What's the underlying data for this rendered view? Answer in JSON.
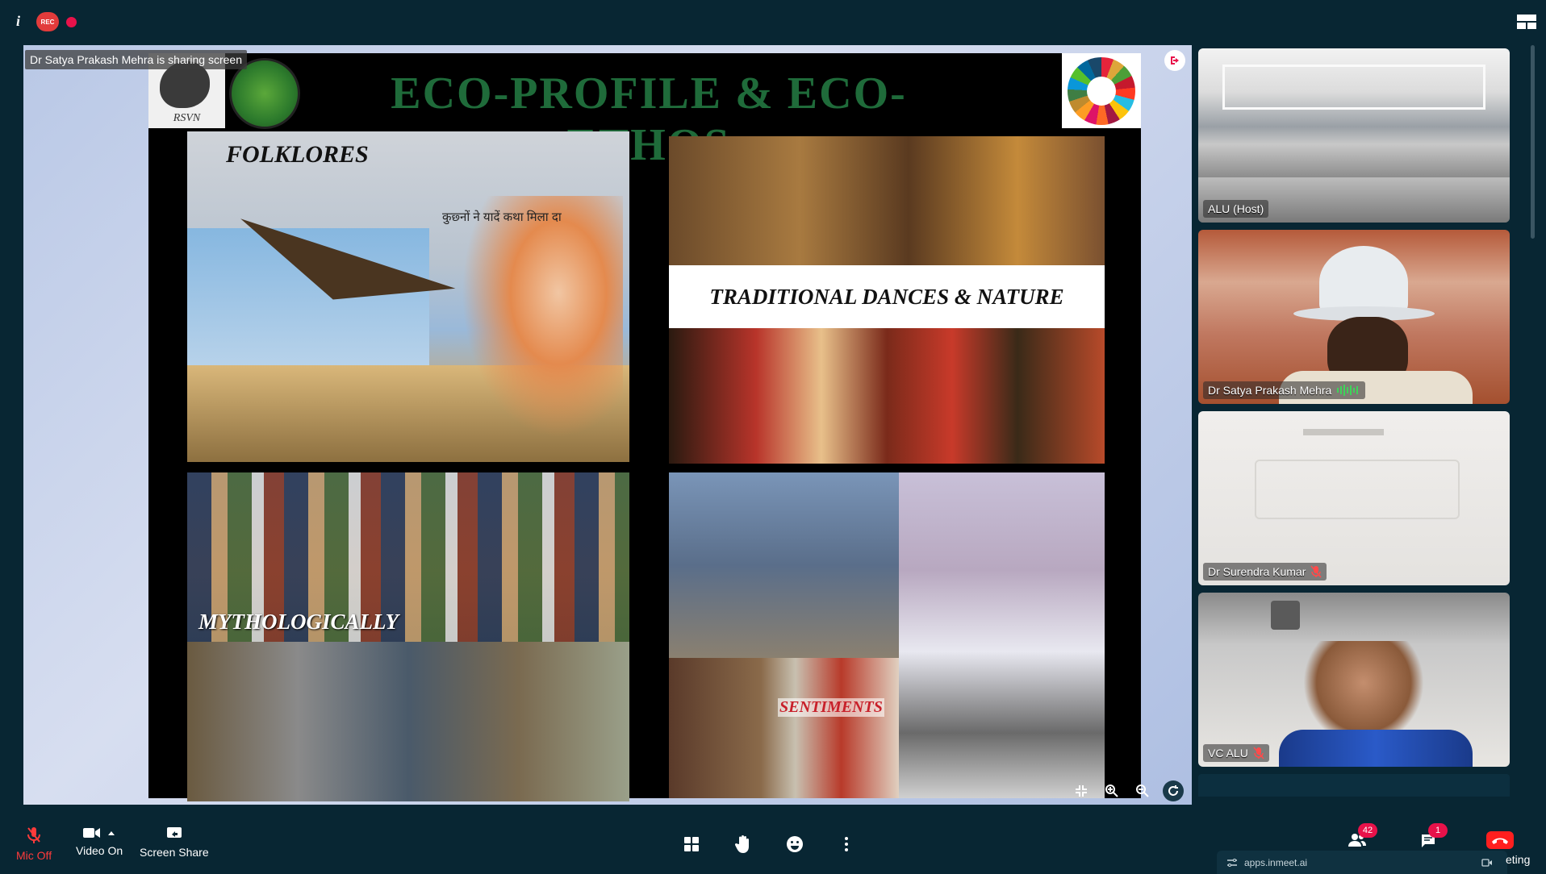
{
  "topbar": {
    "rec_label": "REC"
  },
  "share": {
    "banner": "Dr Satya Prakash Mehra is sharing screen",
    "slide": {
      "title": "ECO-PROFILE & ECO-ETHOS",
      "logo_text": "RSVN",
      "panels": {
        "folklores": "FOLKLORES",
        "folklores_hindi": "कुछ्नों ने यादें कथा मिला दा",
        "dances": "TRADITIONAL DANCES & NATURE",
        "mythology": "MYTHOLOGICALLY",
        "sentiments": "SENTIMENTS"
      }
    }
  },
  "participants": [
    {
      "name": "ALU (Host)",
      "muted": false
    },
    {
      "name": "Dr Satya Prakash Mehra",
      "speaking": true
    },
    {
      "name": "Dr Surendra Kumar",
      "muted": true
    },
    {
      "name": "VC ALU",
      "muted": true
    }
  ],
  "controls": {
    "mic_label": "Mic Off",
    "video_label": "Video On",
    "screen_share_label": "Screen Share",
    "participants_count": "42",
    "chat_count": "1",
    "url": "apps.inmeet.ai",
    "meeting_label": "eting"
  },
  "colors": {
    "background": "#082633",
    "accent_red": "#e8124a",
    "mic_off_red": "#ff3b3b",
    "leave_red": "#ff1f1f"
  }
}
